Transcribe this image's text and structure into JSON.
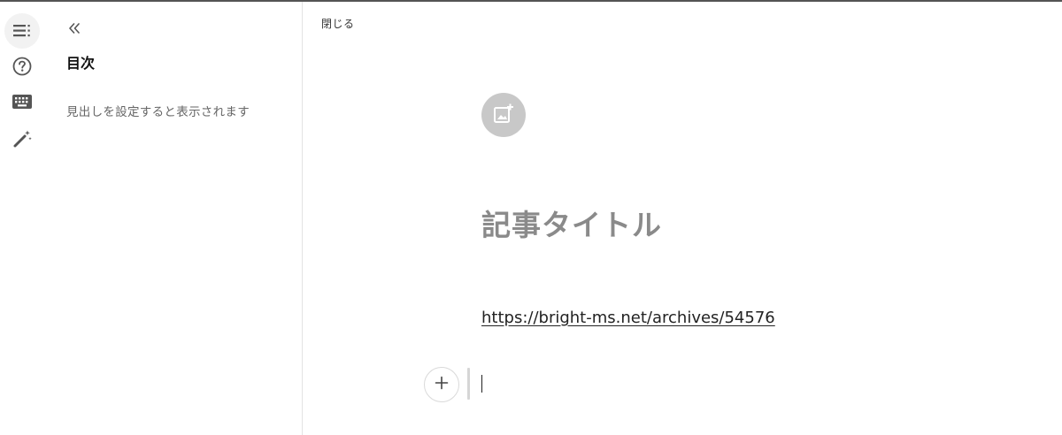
{
  "rail": {
    "items": [
      {
        "icon": "table-of-contents-icon",
        "active": true
      },
      {
        "icon": "help-icon",
        "active": false
      },
      {
        "icon": "keyboard-icon",
        "active": false
      },
      {
        "icon": "magic-wand-icon",
        "active": false
      }
    ]
  },
  "toc": {
    "collapse_icon": "double-chevron-left-icon",
    "title": "目次",
    "empty_message": "見出しを設定すると表示されます"
  },
  "editor": {
    "close_label": "閉じる",
    "eyecatch_icon": "add-image-icon",
    "title_placeholder": "記事タイトル",
    "body_link_text": "https://bright-ms.net/archives/54576",
    "add_block_icon": "plus-icon",
    "current_block_text": ""
  },
  "colors": {
    "accent_border": "#555555",
    "rail_active_bg": "#f2f2f2",
    "eyecatch_bg": "#c8c8c8",
    "title_placeholder": "#8a8a8a"
  }
}
